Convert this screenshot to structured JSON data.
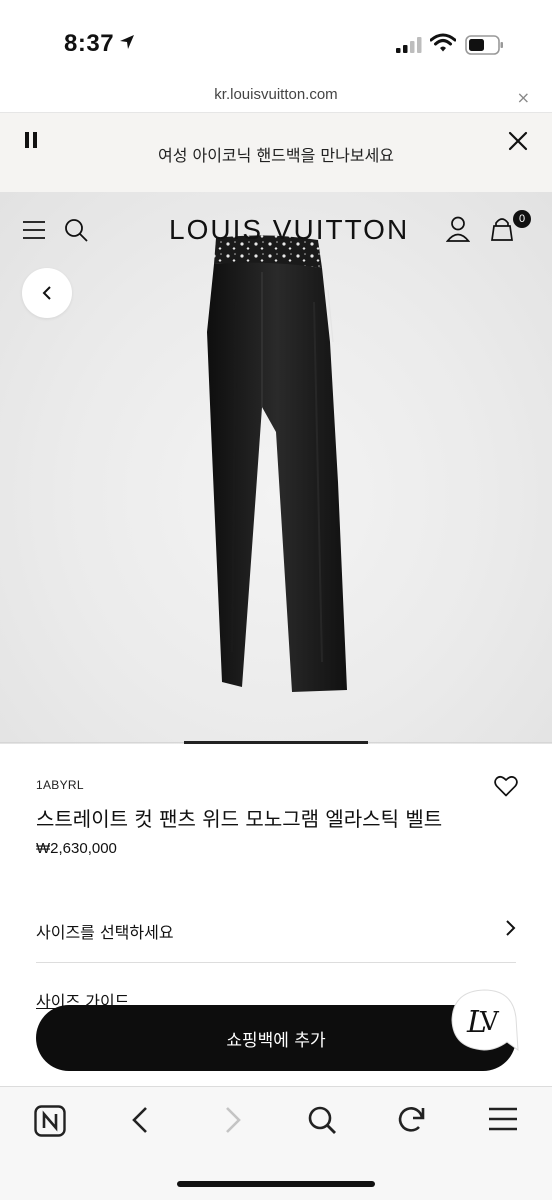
{
  "status_bar": {
    "time": "8:37",
    "icons": [
      "location-arrow-icon",
      "cellular-signal-icon",
      "wifi-icon",
      "battery-icon"
    ]
  },
  "browser": {
    "url": "kr.louisvuitton.com",
    "close_icon": "×"
  },
  "banner": {
    "text": "여성 아이코닉 핸드백을 만나보세요",
    "icons": [
      "pause-icon",
      "close-icon"
    ]
  },
  "header": {
    "logo": "LOUIS VUITTON",
    "bag_count": "0",
    "icons": [
      "menu-icon",
      "search-icon",
      "account-icon",
      "shopping-bag-icon"
    ]
  },
  "product": {
    "sku": "1ABYRL",
    "name": "스트레이트 컷 팬츠 위드 모노그램 엘라스틱 벨트",
    "price": "₩2,630,000",
    "size_label": "사이즈를 선택하세요",
    "size_guide": "사이즈 가이드",
    "add_to_bag": "쇼핑백에 추가",
    "gallery_position": 0.5
  },
  "toolbar": {
    "icons": [
      "naver-home-icon",
      "back-arrow-icon",
      "forward-arrow-icon",
      "search-icon",
      "reload-icon",
      "menu-icon"
    ]
  },
  "colors": {
    "accent": "#0d0d0d",
    "banner_bg": "#f5f4f2",
    "hero_bg": "#ebebeb"
  }
}
